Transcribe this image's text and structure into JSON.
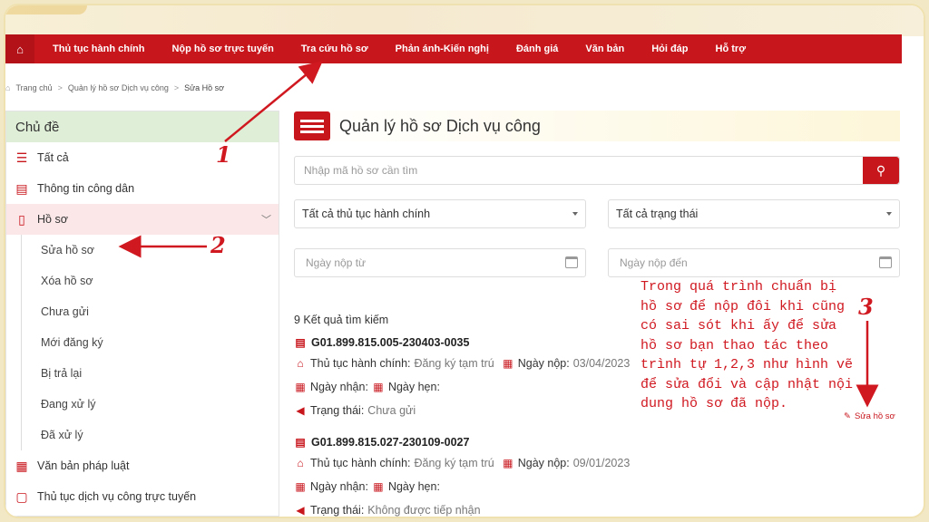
{
  "nav": {
    "home_icon": "home-icon",
    "items": [
      "Thủ tục hành chính",
      "Nộp hồ sơ trực tuyến",
      "Tra cứu hồ sơ",
      "Phản ánh-Kiến nghị",
      "Đánh giá",
      "Văn bản",
      "Hỏi đáp",
      "Hỗ trợ"
    ]
  },
  "breadcrumb": [
    "Trang chủ",
    "Quản lý hồ sơ Dịch vụ công",
    "Sửa Hồ sơ"
  ],
  "sidebar": {
    "title": "Chủ đề",
    "items": [
      {
        "label": "Tất cả",
        "icon": "list-icon"
      },
      {
        "label": "Thông tin công dân",
        "icon": "id-card-icon"
      },
      {
        "label": "Hồ sơ",
        "icon": "bookmark-icon"
      }
    ],
    "sub_items": [
      "Sửa hồ sơ",
      "Xóa hồ sơ",
      "Chưa gửi",
      "Mới đăng ký",
      "Bị trả lại",
      "Đang xử lý",
      "Đã xử lý"
    ],
    "bottom_items": [
      {
        "label": "Văn bản pháp luật",
        "icon": "document-icon"
      },
      {
        "label": "Thủ tục dịch vụ công trực tuyến",
        "icon": "form-icon"
      }
    ]
  },
  "main": {
    "title": "Quản lý hồ sơ Dịch vụ công",
    "search_placeholder": "Nhập mã hồ sơ cần tìm",
    "filter_procedure": "Tất cả thủ tục hành chính",
    "filter_status": "Tất cả trạng thái",
    "date_from_placeholder": "Ngày nộp từ",
    "date_to_placeholder": "Ngày nộp đến",
    "results_count": "9 Kết quả tìm kiếm",
    "records": [
      {
        "code": "G01.899.815.005-230403-0035",
        "procedure_label": "Thủ tục hành chính:",
        "procedure": "Đăng ký tạm trú",
        "submit_label": "Ngày nộp:",
        "submit_date": "03/04/2023",
        "received_label": "Ngày nhận:",
        "appointment_label": "Ngày hẹn:",
        "status_label": "Trạng thái:",
        "status": "Chưa gửi"
      },
      {
        "code": "G01.899.815.027-230109-0027",
        "procedure_label": "Thủ tục hành chính:",
        "procedure": "Đăng ký tạm trú",
        "submit_label": "Ngày nộp:",
        "submit_date": "09/01/2023",
        "received_label": "Ngày nhận:",
        "appointment_label": "Ngày hẹn:",
        "status_label": "Trạng thái:",
        "status": "Không được tiếp nhận"
      }
    ],
    "edit_link": "Sửa hồ sơ"
  },
  "annotation": {
    "note": "Trong quá trình chuẩn bị hồ sơ để nộp đôi khi cũng có sai sót khi ấy để sửa hồ sơ bạn thao tác theo trình tự 1,2,3 như hình vẽ để sửa đổi và cập nhật nội dung hồ sơ đã nộp.",
    "steps": [
      "1",
      "2",
      "3"
    ],
    "color": "#d01820"
  },
  "colors": {
    "brand_red": "#c8161d",
    "sidebar_header": "#dfeed7",
    "active_bg": "#fbe7e7"
  }
}
